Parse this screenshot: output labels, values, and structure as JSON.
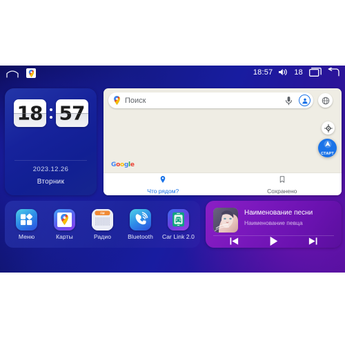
{
  "statusbar": {
    "home_icon": "home-icon",
    "app_icon": "google-maps-icon",
    "time": "18:57",
    "volume_icon": "volume-icon",
    "volume_level": "18",
    "recents_icon": "recents-icon",
    "back_icon": "back-icon"
  },
  "clock": {
    "hours": "18",
    "minutes": "57",
    "date": "2023.12.26",
    "weekday": "Вторник"
  },
  "map": {
    "search_placeholder": "Поиск",
    "pin_icon": "map-pin-icon",
    "mic_icon": "microphone-icon",
    "avatar_icon": "account-avatar-icon",
    "layers_icon": "layers-icon",
    "locate_icon": "my-location-icon",
    "brand": "Google",
    "fab_label": "СТАРТ",
    "nav": [
      {
        "label": "Что рядом?",
        "icon": "pin-icon",
        "active": true
      },
      {
        "label": "Сохранено",
        "icon": "bookmark-icon",
        "active": false
      }
    ]
  },
  "dock": {
    "apps": [
      {
        "label": "Меню",
        "icon": "apps-grid-icon"
      },
      {
        "label": "Карты",
        "icon": "google-maps-icon"
      },
      {
        "label": "Радио",
        "icon": "fm-radio-icon",
        "badge": "FM"
      },
      {
        "label": "Bluetooth",
        "icon": "bluetooth-phone-icon"
      },
      {
        "label": "Car Link 2.0",
        "icon": "car-link-icon"
      }
    ]
  },
  "music": {
    "title": "Наименование песни",
    "artist": "Наименование певца",
    "album_art": "album-art-portrait",
    "prev_icon": "previous-track-icon",
    "play_icon": "play-icon",
    "next_icon": "next-track-icon"
  },
  "colors": {
    "accent_blue": "#1a73e8",
    "map_bg": "#efede4",
    "music_purple": "#7a18bd"
  }
}
